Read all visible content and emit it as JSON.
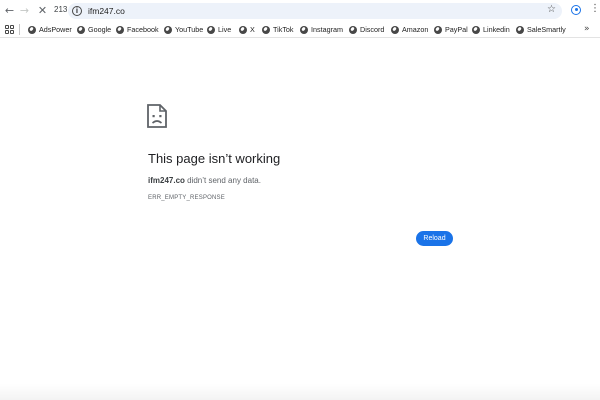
{
  "toolbar": {
    "back_icon": "arrow-left-icon",
    "forward_icon": "arrow-right-icon",
    "stop_icon": "close-icon",
    "tab_count": "213",
    "url": "ifm247.co",
    "bookmark_icon": "star-icon"
  },
  "bookmarks": [
    {
      "label": "AdsPower"
    },
    {
      "label": "Google"
    },
    {
      "label": "Facebook"
    },
    {
      "label": "YouTube"
    },
    {
      "label": "Live"
    },
    {
      "label": "X"
    },
    {
      "label": "TikTok"
    },
    {
      "label": "Instagram"
    },
    {
      "label": "Discord"
    },
    {
      "label": "Amazon"
    },
    {
      "label": "PayPal"
    },
    {
      "label": "Linkedin"
    },
    {
      "label": "SaleSmartly"
    }
  ],
  "error": {
    "title": "This page isn’t working",
    "host": "ifm247.co",
    "message": " didn’t send any data.",
    "code": "ERR_EMPTY_RESPONSE",
    "reload_label": "Reload"
  },
  "colors": {
    "accent": "#1a73e8",
    "omnibox_bg": "#edf2fa"
  }
}
